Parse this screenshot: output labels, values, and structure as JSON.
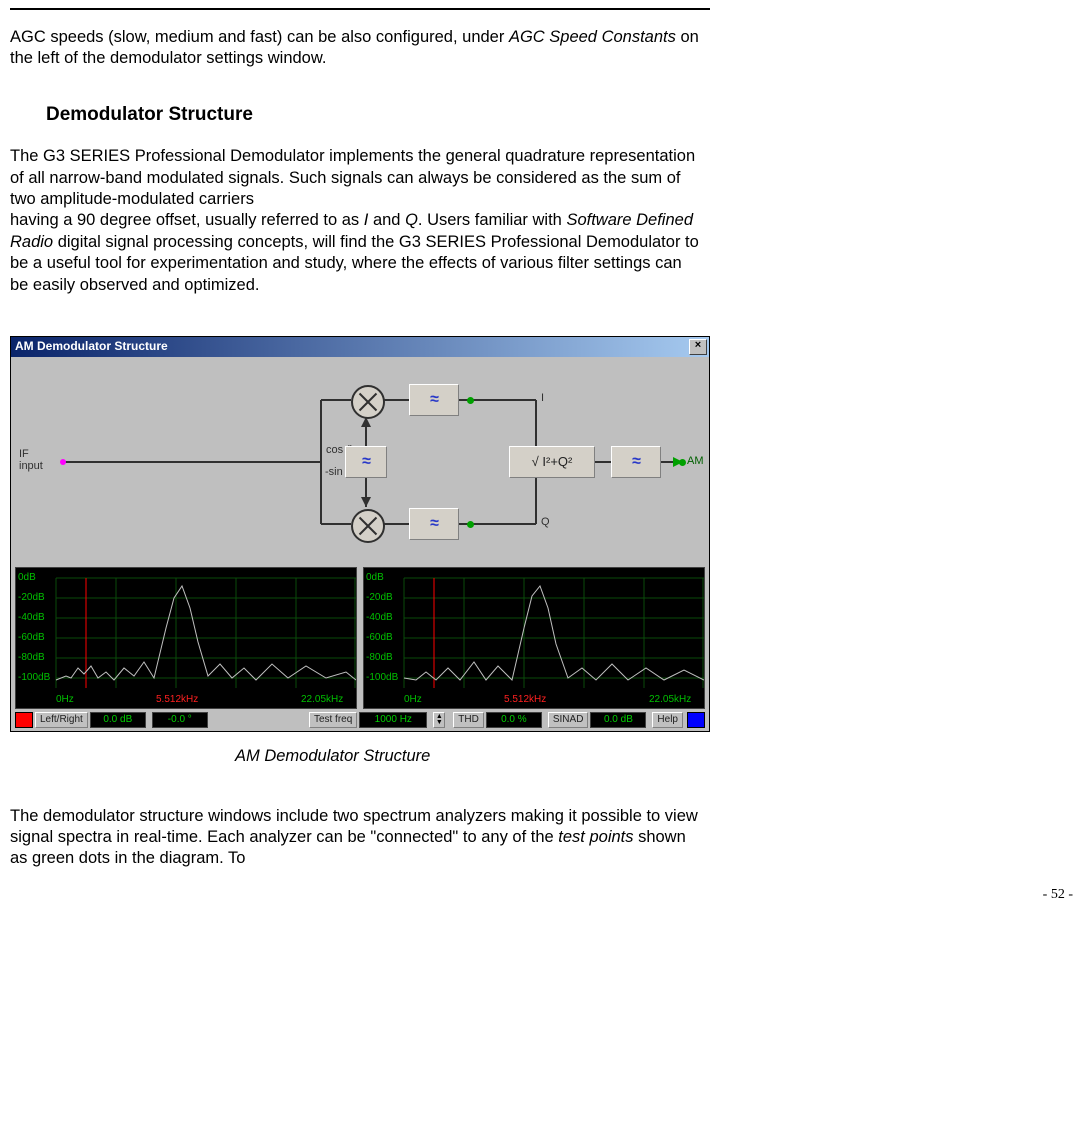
{
  "para1_a": "AGC speeds (slow, medium and fast) can be also configured, under ",
  "para1_em1": "AGC Speed Constants",
  "para1_b": " on the left of the demodulator settings window.",
  "heading": "Demodulator Structure",
  "para2_a": "The G3 SERIES Professional Demodulator implements the general quadrature representation of all narrow-band modulated signals. Such signals can always be considered as the sum of two amplitude-modulated carriers",
  "para2_b1": "having a 90 degree offset, usually referred to as ",
  "para2_emI": "I",
  "para2_b2": " and ",
  "para2_emQ": "Q",
  "para2_b3": ". Users familiar with ",
  "para2_emSDR": "Software Defined Radio",
  "para2_b4": " digital signal processing concepts, will find the G3 SERIES Professional Demodulator to be a useful tool for experimentation and study, where the effects of various filter settings can be easily observed and optimized.",
  "window": {
    "title": "AM Demodulator Structure",
    "labels": {
      "if_input1": "IF",
      "if_input2": "input",
      "cos": "cos ()",
      "sin": "-sin ()",
      "I": "I",
      "Q": "Q",
      "mag": "√ I²+Q²",
      "AM": "AM"
    },
    "spectrum": {
      "ylabels": [
        "0dB",
        "-20dB",
        "-40dB",
        "-60dB",
        "-80dB",
        "-100dB"
      ],
      "xlabels": {
        "left": "0Hz",
        "center": "5.512kHz",
        "right": "22.05kHz"
      }
    },
    "toolbar": {
      "leftright": "Left/Right",
      "val1": "0.0 dB",
      "val2": "-0.0 °",
      "testfreq_label": "Test freq",
      "testfreq_val": "1000  Hz",
      "thd_label": "THD",
      "thd_val": "0.0 %",
      "sinad_label": "SINAD",
      "sinad_val": "0.0 dB",
      "help": "Help"
    }
  },
  "caption": "AM Demodulator Structure",
  "para3_a": "The demodulator structure windows include two spectrum analyzers making it possible to view signal spectra in real-time. Each analyzer can be \"connected\" to any of the ",
  "para3_em": "test points",
  "para3_b": " shown as green dots in the diagram. To",
  "page_number": "- 52 -"
}
